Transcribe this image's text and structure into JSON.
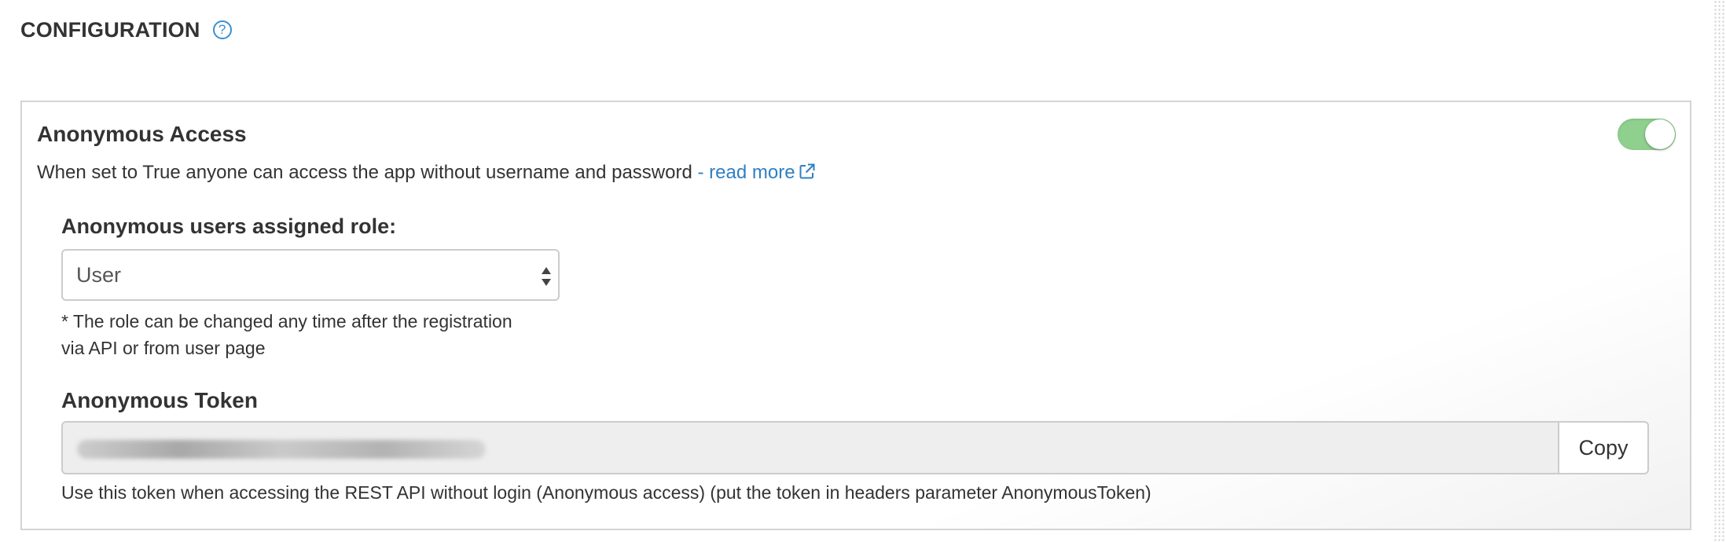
{
  "header": {
    "title": "CONFIGURATION",
    "help_icon": "?"
  },
  "anonymous_access": {
    "title": "Anonymous Access",
    "toggle_state": true,
    "description": "When set to True anyone can access the app without username and password",
    "read_more_label": "- read more",
    "role_label": "Anonymous users assigned role:",
    "role_value": "User",
    "role_hint_line1": "* The role can be changed any time after the registration",
    "role_hint_line2": "via API or from user page",
    "token_label": "Anonymous Token",
    "copy_label": "Copy",
    "token_hint": "Use this token when accessing the REST API without login (Anonymous access) (put the token in headers parameter AnonymousToken)"
  },
  "colors": {
    "link": "#2f7fc3",
    "toggle_on": "#8fd08f",
    "text": "#333333"
  },
  "icons": [
    "help-circle-icon",
    "external-link-icon",
    "select-arrows-icon"
  ]
}
